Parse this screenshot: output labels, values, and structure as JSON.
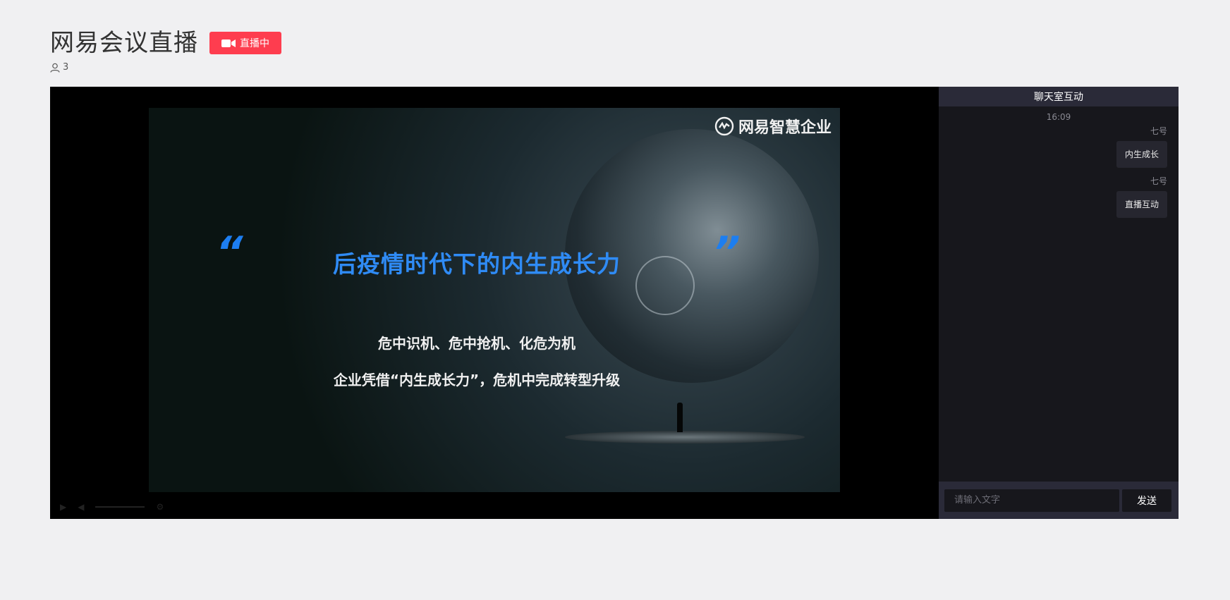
{
  "header": {
    "title": "网易会议直播",
    "live_badge": "直播中",
    "viewer_count": "3"
  },
  "video": {
    "brand": "网易智慧企业",
    "quote_open": "“",
    "quote_close": "”",
    "slide_title": "后疫情时代下的内生成长力",
    "slide_line_1": "危中识机、危中抢机、化危为机",
    "slide_line_2": "企业凭借“内生成长力”，危机中完成转型升级"
  },
  "chat": {
    "title": "聊天室互动",
    "time": "16:09",
    "messages": [
      {
        "name": "七号",
        "text": "内生成长"
      },
      {
        "name": "七号",
        "text": "直播互动"
      }
    ],
    "input_placeholder": "请输入文字",
    "send_label": "发送"
  },
  "colors": {
    "live_badge": "#fe3d4f",
    "slide_title": "#2f8bf5",
    "chat_bg": "#17171c",
    "chat_header": "#2a2a38"
  }
}
